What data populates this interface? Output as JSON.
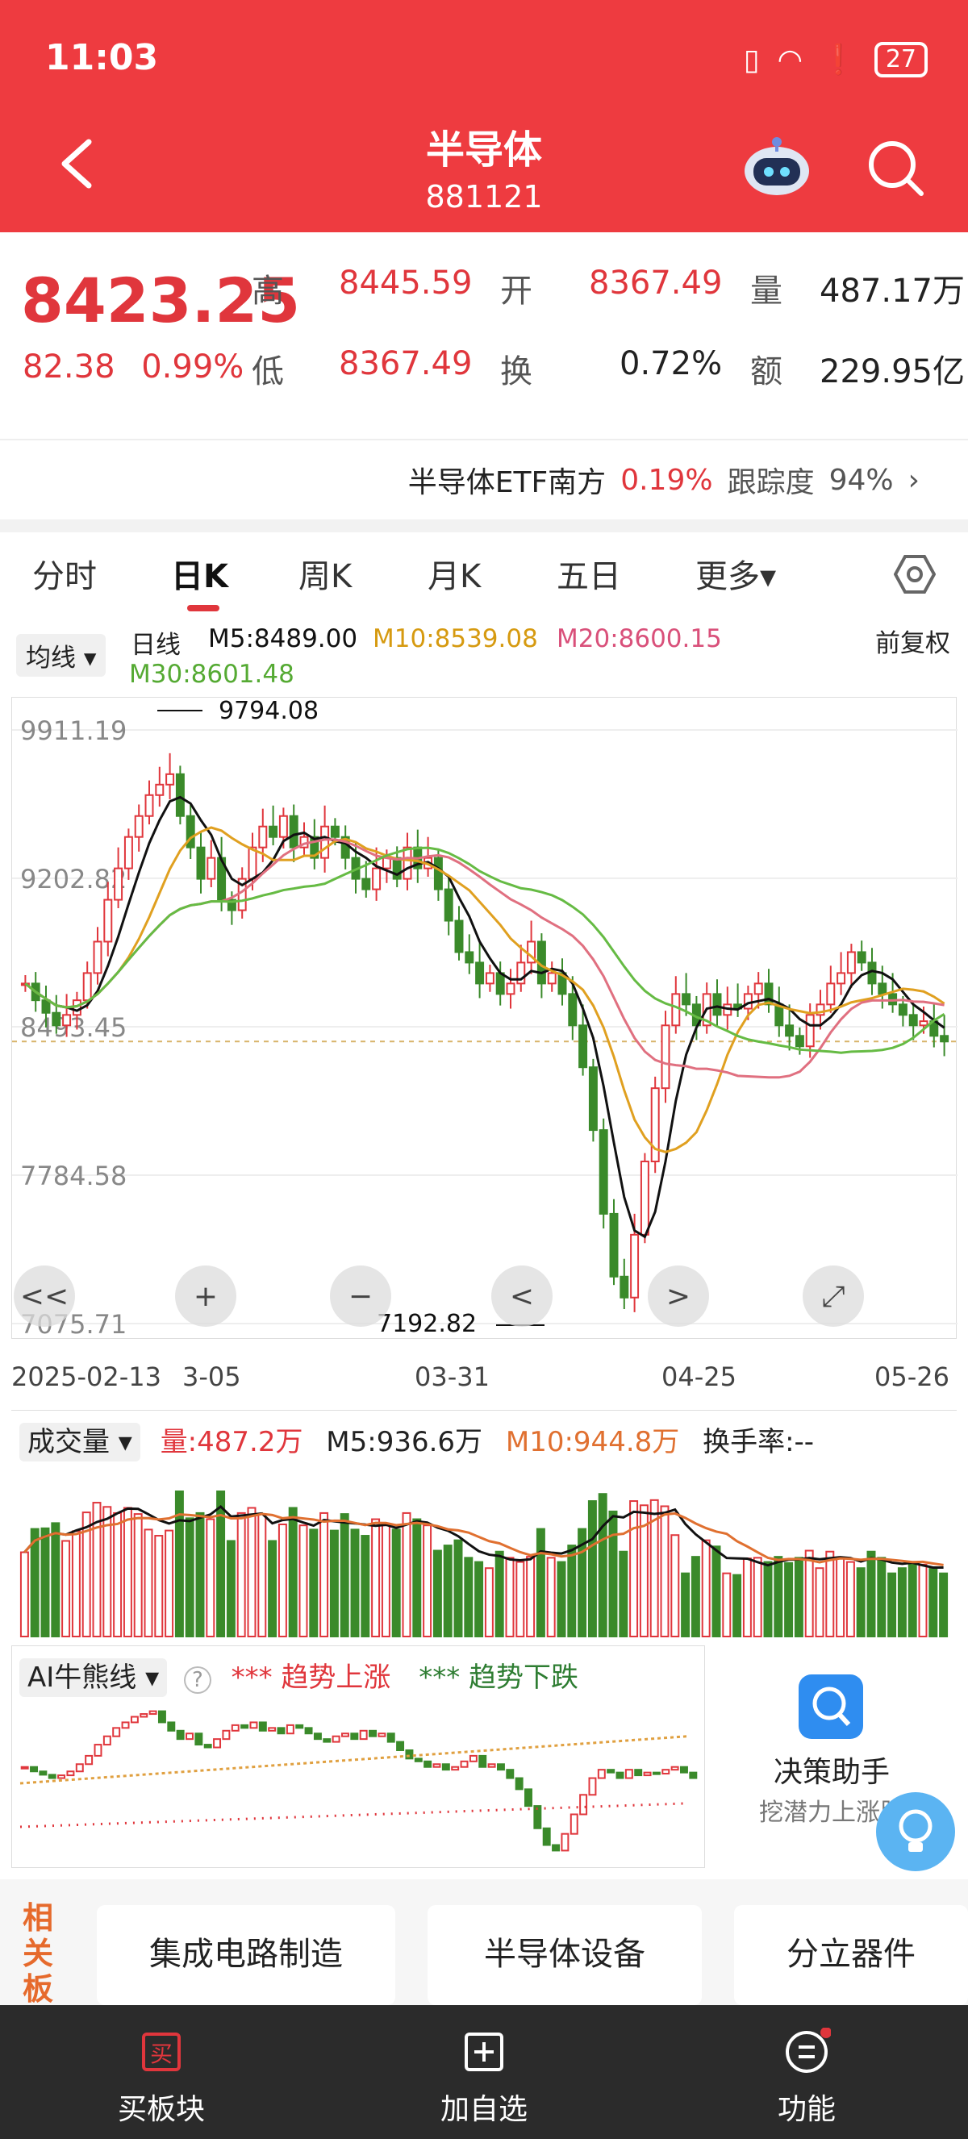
{
  "status": {
    "time": "11:03",
    "battery": "27"
  },
  "header": {
    "title": "半导体",
    "code": "881121"
  },
  "quote": {
    "price": "8423.25",
    "change": "82.38",
    "change_pct": "0.99%",
    "high_label": "高",
    "high": "8445.59",
    "open_label": "开",
    "open": "8367.49",
    "vol_label": "量",
    "vol": "487.17万",
    "low_label": "低",
    "low": "8367.49",
    "turnover_label": "换",
    "turnover": "0.72%",
    "amount_label": "额",
    "amount": "229.95亿"
  },
  "etf": {
    "name": "半导体ETF南方",
    "pct": "0.19%",
    "track_label": "跟踪度",
    "track": "94%"
  },
  "tabs": [
    "分时",
    "日K",
    "周K",
    "月K",
    "五日",
    "更多▾"
  ],
  "ma": {
    "selector": "均线 ▾",
    "period": "日线",
    "m5": "M5:8489.00",
    "m10": "M10:8539.08",
    "m20": "M20:8600.15",
    "m30": "M30:8601.48",
    "adjust": "前复权"
  },
  "kline": {
    "y_labels": [
      "9911.19",
      "9202.82",
      "8493.45",
      "7784.58",
      "7075.71"
    ],
    "max_label": "9794.08",
    "min_label": "7192.82",
    "x_labels": [
      "2025-02-13",
      "3-05",
      "03-31",
      "04-25",
      "05-26"
    ]
  },
  "volume": {
    "selector": "成交量 ▾",
    "vol": "量:487.2万",
    "m5": "M5:936.6万",
    "m10": "M10:944.8万",
    "turnover": "换手率:--"
  },
  "ai": {
    "selector": "AI牛熊线 ▾",
    "up": "*** 趋势上涨",
    "down": "*** 趋势下跌"
  },
  "helper": {
    "title": "决策助手",
    "subtitle": "挖潜力上涨股"
  },
  "related": {
    "side": "相关板",
    "items": [
      "集成电路制造",
      "半导体设备",
      "分立器件"
    ]
  },
  "bottom_nav": [
    "买板块",
    "加自选",
    "功能"
  ],
  "chart_data": {
    "type": "candlestick",
    "x": [
      "2025-02-13",
      "3-05",
      "03-31",
      "04-25",
      "05-26"
    ],
    "y_ticks": [
      9911.19,
      9202.82,
      8493.45,
      7784.58,
      7075.71
    ],
    "ylim": [
      7075.71,
      9911.19
    ],
    "high_marker": 9794.08,
    "low_marker": 7192.82,
    "ma_series": [
      {
        "name": "M5",
        "last": 8489.0,
        "color": "#111111"
      },
      {
        "name": "M10",
        "last": 8539.08,
        "color": "#e0a020"
      },
      {
        "name": "M20",
        "last": 8600.15,
        "color": "#e07080"
      },
      {
        "name": "M30",
        "last": 8601.48,
        "color": "#66bb44"
      }
    ],
    "closes": [
      8700,
      8620,
      8560,
      8500,
      8550,
      8620,
      8750,
      8900,
      9100,
      9250,
      9400,
      9500,
      9600,
      9650,
      9700,
      9500,
      9350,
      9200,
      9300,
      9100,
      9050,
      9200,
      9350,
      9450,
      9400,
      9500,
      9350,
      9400,
      9300,
      9450,
      9400,
      9300,
      9200,
      9150,
      9250,
      9300,
      9200,
      9350,
      9250,
      9300,
      9150,
      9000,
      8850,
      8800,
      8700,
      8750,
      8650,
      8700,
      8800,
      8900,
      8700,
      8750,
      8650,
      8500,
      8300,
      8000,
      7600,
      7300,
      7200,
      7500,
      7850,
      8200,
      8500,
      8650,
      8600,
      8500,
      8650,
      8550,
      8600,
      8580,
      8650,
      8700,
      8600,
      8500,
      8450,
      8400,
      8550,
      8600,
      8700,
      8750,
      8850,
      8800,
      8700,
      8650,
      8600,
      8550,
      8500,
      8520,
      8450,
      8423
    ]
  }
}
